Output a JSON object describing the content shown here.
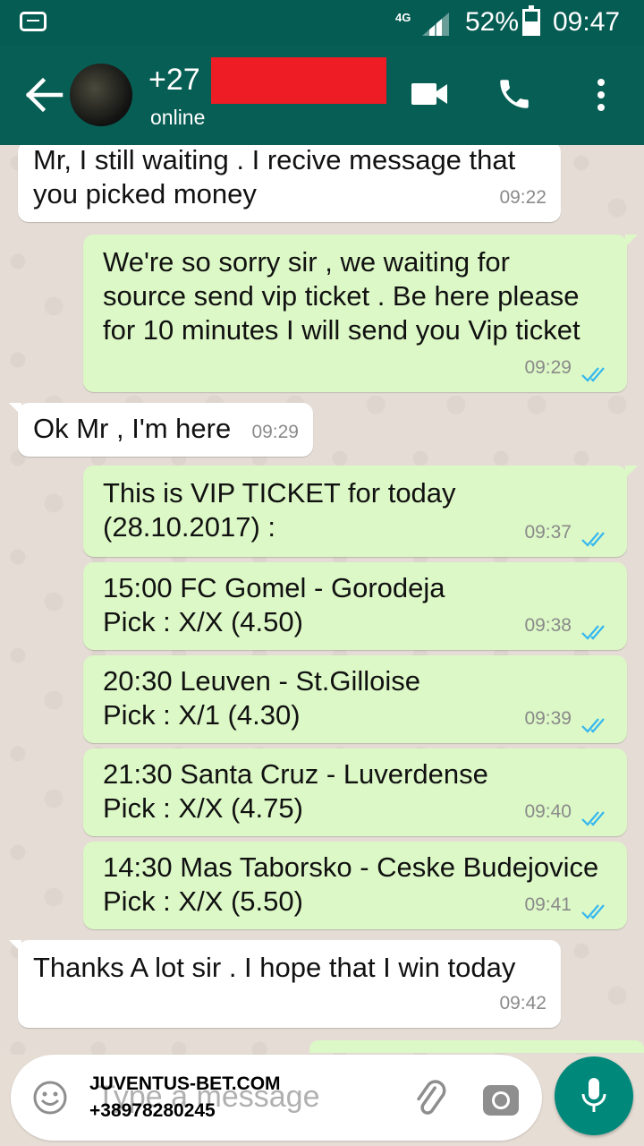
{
  "status_bar": {
    "network": "4G",
    "battery": "52%",
    "time": "09:47"
  },
  "contact": {
    "name": "+27",
    "status": "online"
  },
  "messages": [
    {
      "dir": "in",
      "text": "Mr, I still waiting . I recive message that\nyou picked money",
      "time": "09:22"
    },
    {
      "dir": "out",
      "text": "We're so sorry sir , we waiting for\nsource send vip ticket . Be here please\nfor 10 minutes I will send you Vip ticket",
      "time": "09:29"
    },
    {
      "dir": "in",
      "text": "Ok Mr , I'm here",
      "time": "09:29"
    },
    {
      "dir": "out",
      "text": "This is VIP TICKET for today\n(28.10.2017) :",
      "time": "09:37"
    },
    {
      "dir": "out",
      "text": "15:00 FC Gomel - Gorodeja\nPick : X/X (4.50)",
      "time": "09:38"
    },
    {
      "dir": "out",
      "text": "20:30 Leuven - St.Gilloise\nPick : X/1 (4.30)",
      "time": "09:39"
    },
    {
      "dir": "out",
      "text": "21:30 Santa Cruz - Luverdense\nPick : X/X (4.75)",
      "time": "09:40"
    },
    {
      "dir": "out",
      "text": "14:30 Mas Taborsko - Ceske Budejovice\nPick : X/X (5.50)",
      "time": "09:41"
    },
    {
      "dir": "in",
      "text": "Thanks A lot sir . I hope that I win today",
      "time": "09:42"
    }
  ],
  "input": {
    "placeholder": "Type a message",
    "watermark_line1": "JUVENTUS-BET.COM",
    "watermark_line2": "+38978280245"
  },
  "colors": {
    "header": "#075e54",
    "statusbar": "#055c53",
    "outgoing": "#dcf8c6",
    "incoming": "#ffffff",
    "ticks": "#34b7f1",
    "mic": "#00897b"
  },
  "icons": [
    "back-arrow-icon",
    "video-call-icon",
    "phone-icon",
    "more-vert-icon",
    "emoji-icon",
    "attach-icon",
    "camera-icon",
    "mic-icon",
    "double-check-icon"
  ]
}
